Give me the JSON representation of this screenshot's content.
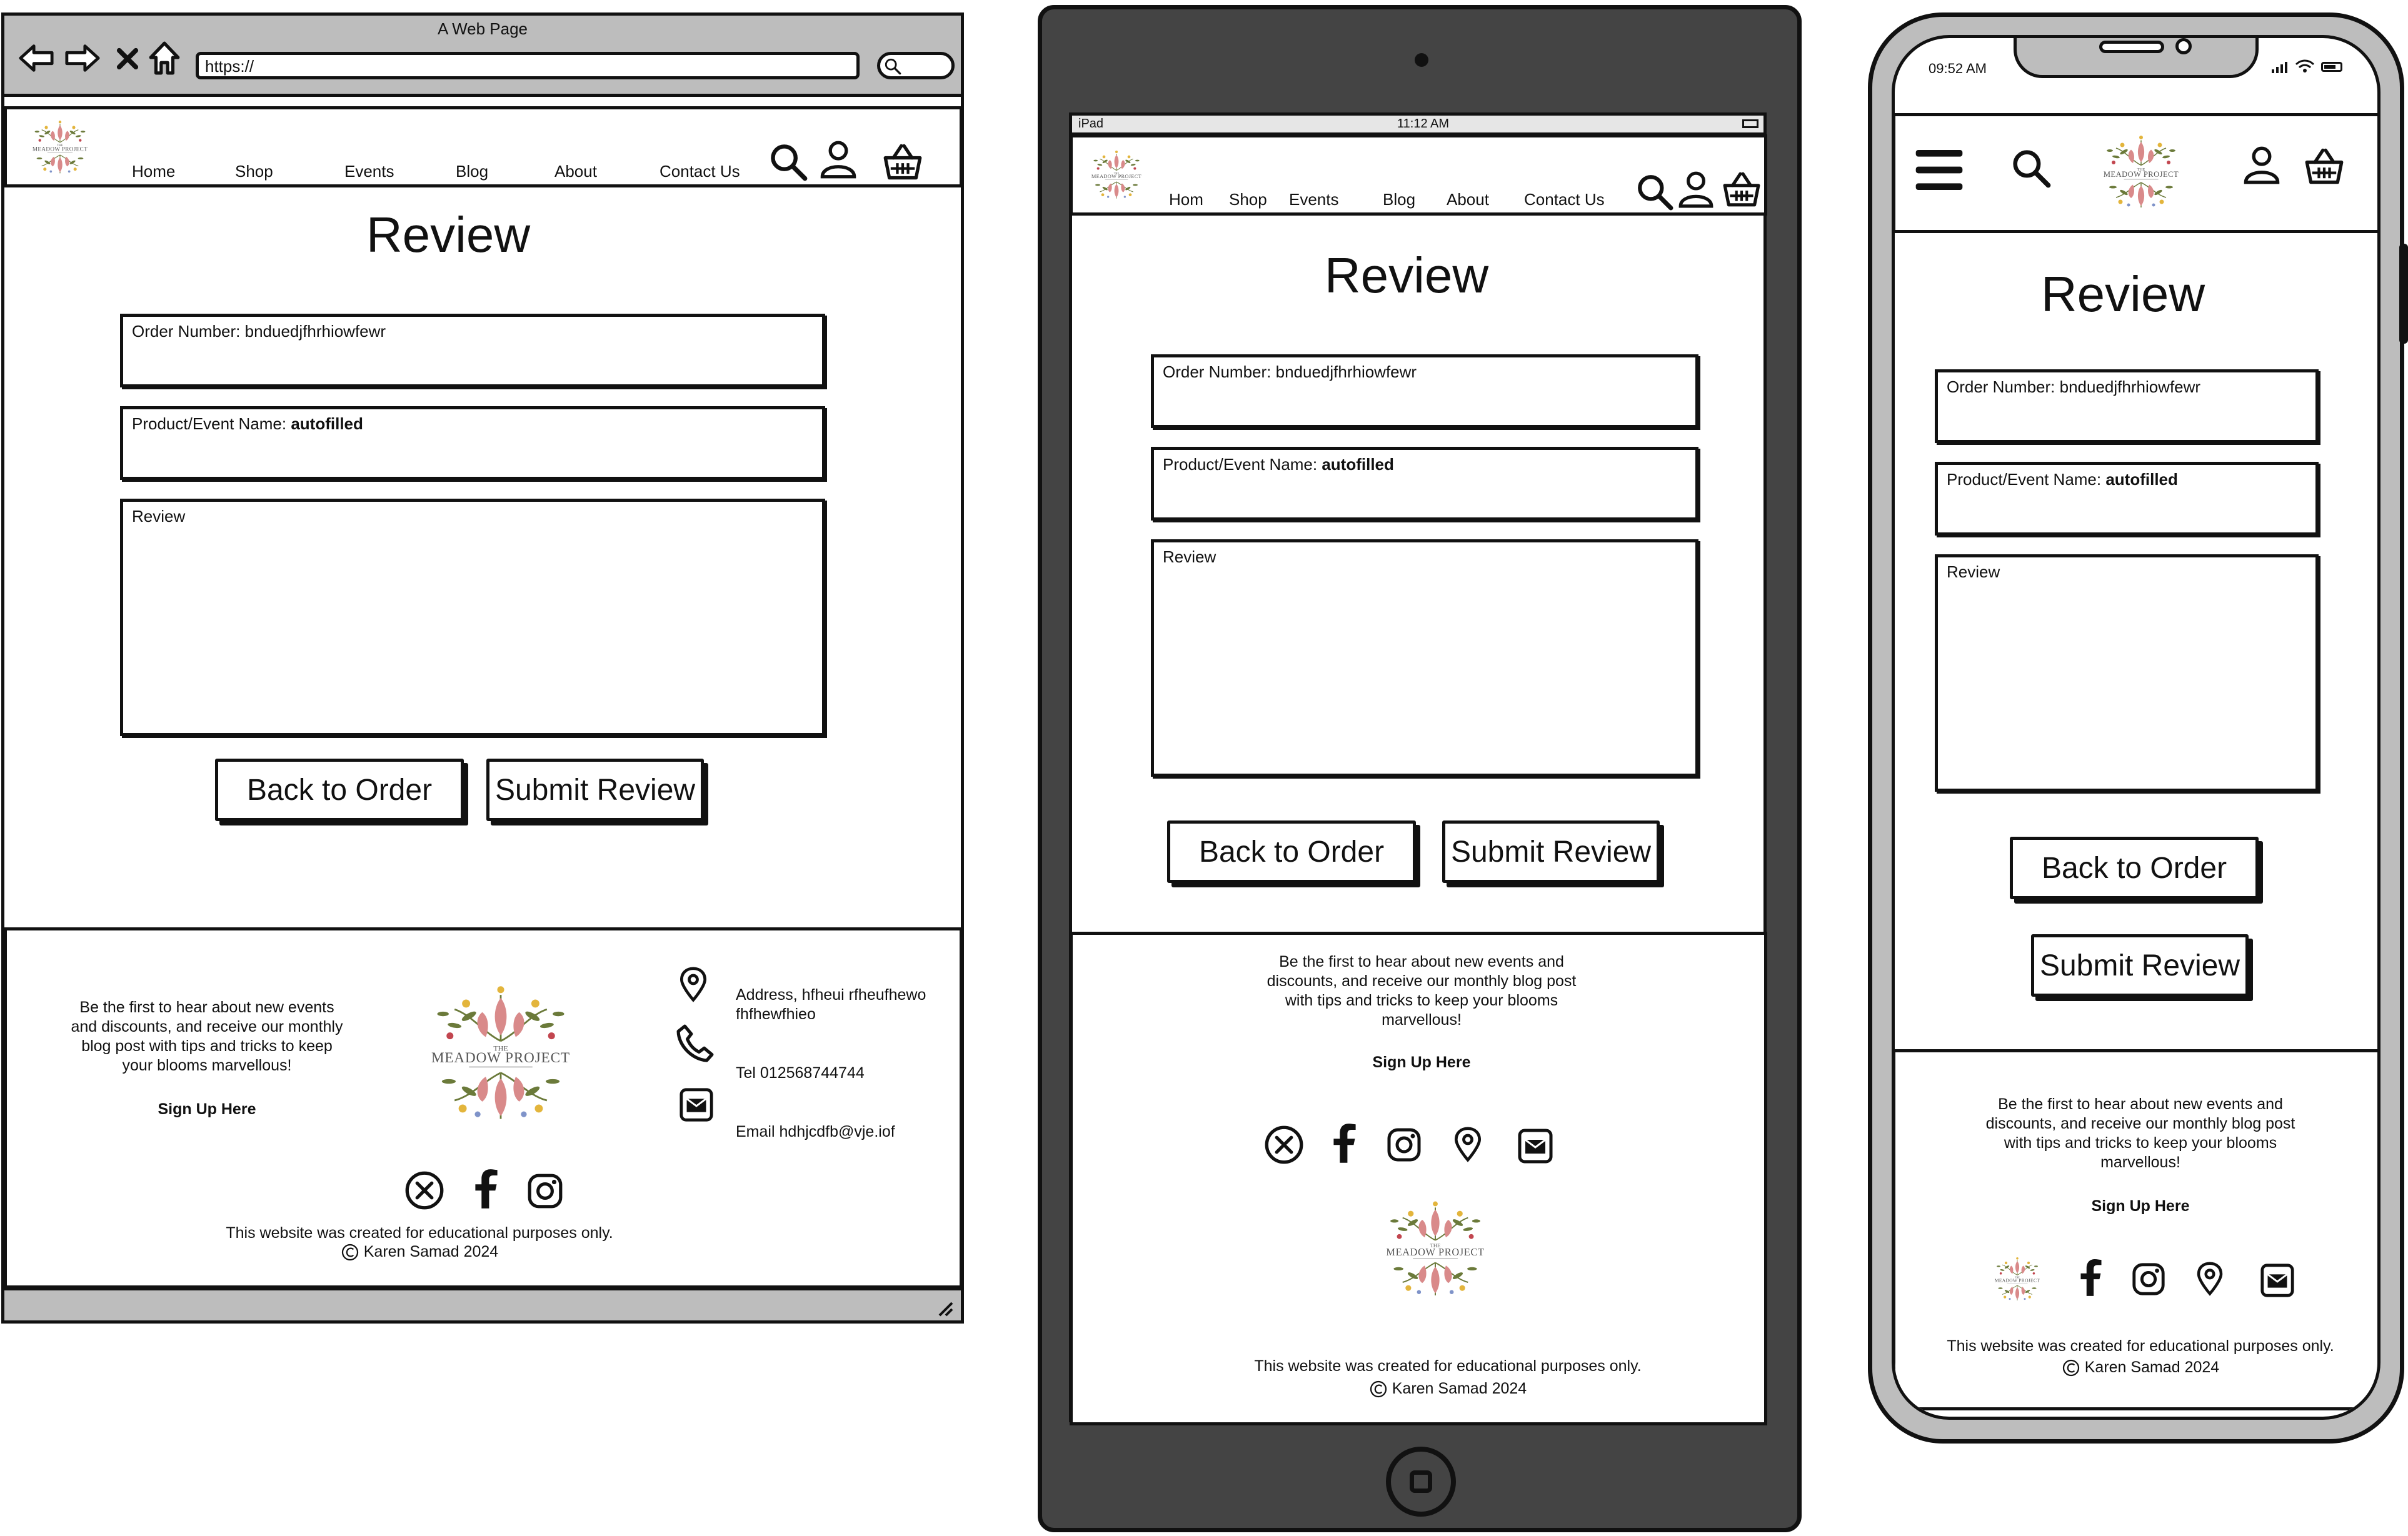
{
  "browser": {
    "title": "A Web Page",
    "url": "https://",
    "nav_icons": [
      "back-arrow-icon",
      "forward-arrow-icon",
      "close-icon",
      "home-icon"
    ]
  },
  "nav": {
    "items": [
      "Home",
      "Shop",
      "Events",
      "Blog",
      "About",
      "Contact Us"
    ],
    "tablet_items": [
      "Hom",
      "Shop",
      "Events",
      "Blog",
      "About",
      "Contact Us"
    ],
    "icons": [
      "search-icon",
      "user-icon",
      "basket-icon"
    ]
  },
  "brand": {
    "logo_text": "THE MEADOW PROJECT",
    "logo_top": "THE",
    "logo_main": "MEADOW PROJECT"
  },
  "page": {
    "heading": "Review"
  },
  "form": {
    "order_label": "Order Number: bnduedjfhrhiowfewr",
    "product_label_prefix": "Product/Event Name: ",
    "product_label_value": "autofilled",
    "review_label": "Review"
  },
  "buttons": {
    "back": "Back to Order",
    "submit": "Submit Review"
  },
  "footer": {
    "blurb": "Be the first to hear about new events and discounts, and receive our monthly blog post with tips and tricks to keep your blooms marvellous!",
    "signup": "Sign Up Here",
    "address": "Address, hfheui rfheufhewo fhfhewfhieo",
    "tel": "Tel 012568744744",
    "email": "Email hdhjcdfb@vje.iof",
    "disclaimer": "This website was created for educational purposes only.",
    "copyright": "Karen Samad 2024",
    "social_icons": [
      "x-icon",
      "facebook-icon",
      "instagram-icon"
    ]
  },
  "tablet": {
    "status_left": "iPad",
    "status_time": "11:12 AM"
  },
  "phone": {
    "status_time": "09:52 AM"
  },
  "colors": {
    "device_dark": "#444444",
    "chrome_gray": "#bdbdbd",
    "ink": "#111111",
    "logo_pink": "#d98a8a",
    "logo_green": "#6b7a3a"
  }
}
